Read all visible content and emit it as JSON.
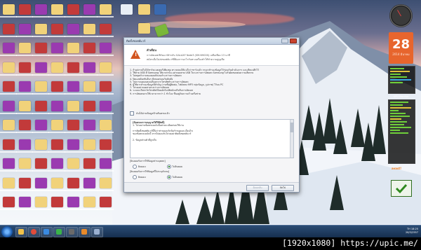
{
  "dialog": {
    "title": "ติดตั้งซอฟต์แวร์",
    "header_title": "คำเตือน",
    "header_lines": [
      "การอัพเดทเฟิร์มแวร์สำหรับ GALAXY Note3 (SM-N900S) เหลือเพียง 13 นาที",
      "สมัครเมื่อไม่ส่งซอฟต์แวร์ที่ต้องการอะไรกับทางเครื่องทำให้ทำความสูญเสีย"
    ],
    "body_lines": [
      "1. ถ้าอุปกรณ์ไม่ได้ชาร์จแบตเตอรี่เพียงพอ ตรวจสอบให้แน่ใจว่าชาร์จแล้ว กรุณาสำรองข้อมูลไว้ก่อนเริ่มดำเนินการ และเสียบปลั๊กไว้",
      "2. ใช้สาย USB ที่ Samsung ให้มาเท่านั้น อย่าถอดสาย USB ในระหว่างการอัพเดท Samsung ไม่รับผิดชอบต่อความเสียหาย",
      "3. ไม่หยุดทำงานของคอมพิวเตอร์ระหว่างการอัพเดท",
      "4. ปิดแอพลิเคชันอื่นๆ ทั้งหมดก่อนเริ่มติดตั้ง",
      "5. ไม่ควรถอดแบตเตอรี่ออกจากโทรศัพท์ระหว่างการอัพเดท",
      "6. ผู้ใช้ควรสำรองข้อมูลที่สำคัญ (รายชื่อผู้ติดต่อ, ไฟล์เพลง MP3 กลุ่มข้อมูล, รูปภาพ) ไว้บน PC",
      "7. โปรดอย่าถอดสายระหว่างการอัพเดท",
      "8. ระบบจะรีสตาร์ทโทรศัพท์โดยอัตโนมัติหลังเสร็จสิ้นการอัพเดท",
      "9. การอัพเดทอาจใช้เวลามากกว่า 1 ชั่วโมง ขึ้นอยู่กับความเร็วเครือข่าย"
    ],
    "checkbox_label": "ฉันได้อ่านข้อมูลข้างต้นครบแล้ว",
    "terms_lines": [
      "[ข้อตกลงการอนุญาตให้ใช้สิทธิ์]",
      "1. โปรดอ่านข้อตกลงฉบับนี้อย่างละเอียดก่อนใช้งาน",
      "การติดตั้งซอฟต์แวร์นี้ถือว่าท่านยอมรับข้อกำหนดและเงื่อนไข",
      "ของข้อตกลงฉบับนี้ หากไม่ยอมรับโปรดอย่าติดตั้งซอฟต์แวร์",
      "2. ข้อมูลส่วนตัวที่ถูกเก็บ"
    ],
    "question1": "[ยินยอมรับการใช้ข้อมูลส่วนบุคคล]",
    "q1_options": [
      "ยินยอม",
      "ไม่ยินยอม"
    ],
    "question2": "[ยินยอมรับการใช้ข้อมูลที่ไม่ระบุตัวตน]",
    "q2_options": [
      "ยินยอม",
      "ไม่ยินยอม"
    ],
    "back_button": "ย้อนกลับ",
    "next_button": "ถัดไป"
  },
  "gadgets": {
    "calendar_day": "28",
    "calendar_month": "2014 มีนาคม",
    "gpu_label": "GPU Monitor",
    "avast_label": "avast!"
  },
  "taskbar": {
    "time": "18:25",
    "date": "28/3/2557",
    "lang": "TH"
  },
  "caption": "[1920x1080] https://upic.me/"
}
